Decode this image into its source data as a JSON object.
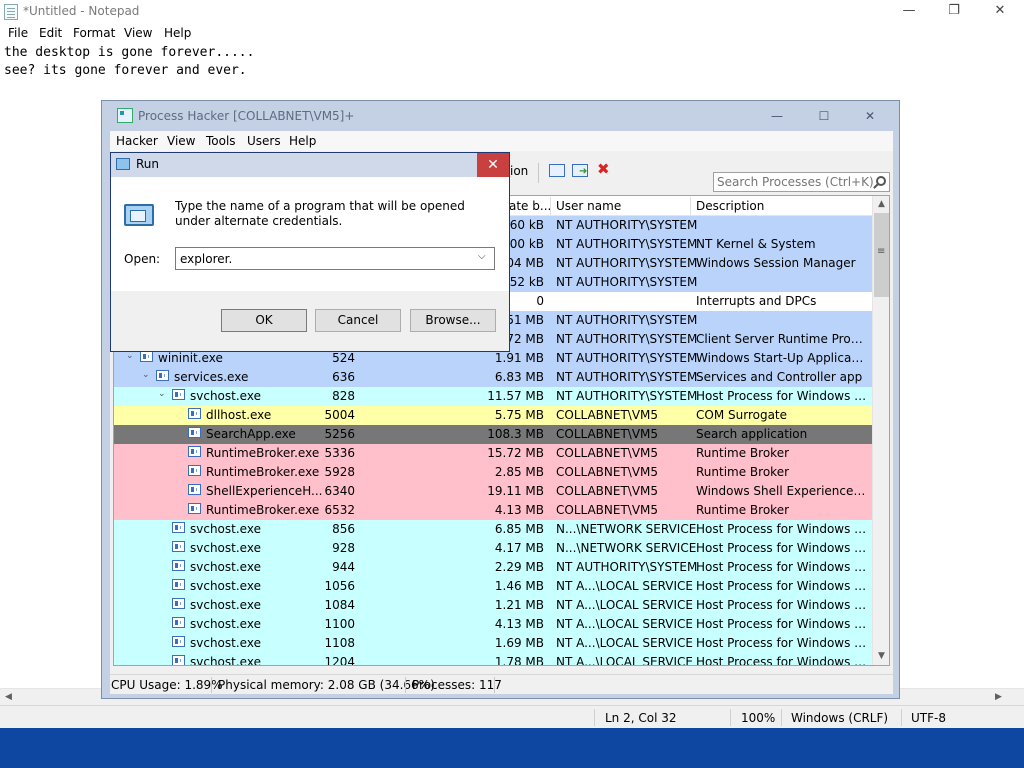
{
  "notepad": {
    "title": "*Untitled - Notepad",
    "window_buttons": {
      "minimize": "—",
      "maximize": "❐",
      "close": "✕"
    },
    "menu": [
      "File",
      "Edit",
      "Format",
      "View",
      "Help"
    ],
    "text_lines": [
      "the desktop is gone forever.....",
      "see? its gone forever and ever."
    ],
    "status": {
      "position": "Ln 2, Col 32",
      "zoom": "100%",
      "line_ending": "Windows (CRLF)",
      "encoding": "UTF-8"
    }
  },
  "process_hacker": {
    "title": "Process Hacker [COLLABNET\\VM5]+",
    "window_buttons": {
      "minimize": "—",
      "maximize": "☐",
      "close": "✕"
    },
    "menu": [
      "Hacker",
      "View",
      "Tools",
      "Users",
      "Help"
    ],
    "toolbar": {
      "partial_label": "ion"
    },
    "search_placeholder": "Search Processes (Ctrl+K)",
    "columns": {
      "private_bytes": "ate b...",
      "user_name": "User name",
      "description": "Description"
    },
    "rows": [
      {
        "name": "",
        "pid": "",
        "mem": "60 kB",
        "user": "NT AUTHORITY\\SYSTEM",
        "desc": "",
        "color": "#b9d3fb",
        "indent": 0,
        "expander": ""
      },
      {
        "name": "",
        "pid": "",
        "mem": "200 kB",
        "user": "NT AUTHORITY\\SYSTEM",
        "desc": "NT Kernel & System",
        "color": "#b9d3fb",
        "indent": 0,
        "expander": ""
      },
      {
        "name": "",
        "pid": "",
        "mem": "04 MB",
        "user": "NT AUTHORITY\\SYSTEM",
        "desc": "Windows Session Manager",
        "color": "#b9d3fb",
        "indent": 0,
        "expander": ""
      },
      {
        "name": "",
        "pid": "",
        "mem": "252 kB",
        "user": "NT AUTHORITY\\SYSTEM",
        "desc": "",
        "color": "#b9d3fb",
        "indent": 0,
        "expander": ""
      },
      {
        "name": "",
        "pid": "",
        "mem": "0",
        "user": "",
        "desc": "Interrupts and DPCs",
        "color": "#ffffff",
        "indent": 0,
        "expander": ""
      },
      {
        "name": "",
        "pid": "",
        "mem": "51 MB",
        "user": "NT AUTHORITY\\SYSTEM",
        "desc": "",
        "color": "#b9d3fb",
        "indent": 0,
        "expander": ""
      },
      {
        "name": "",
        "pid": "",
        "mem": "72 MB",
        "user": "NT AUTHORITY\\SYSTEM",
        "desc": "Client Server Runtime Process",
        "color": "#b9d3fb",
        "indent": 0,
        "expander": ""
      },
      {
        "name": "wininit.exe",
        "pid": "524",
        "mem": "1.91 MB",
        "user": "NT AUTHORITY\\SYSTEM",
        "desc": "Windows Start-Up Application",
        "color": "#b9d3fb",
        "indent": 0,
        "expander": "⌄"
      },
      {
        "name": "services.exe",
        "pid": "636",
        "mem": "6.83 MB",
        "user": "NT AUTHORITY\\SYSTEM",
        "desc": "Services and Controller app",
        "color": "#b9d3fb",
        "indent": 1,
        "expander": "⌄"
      },
      {
        "name": "svchost.exe",
        "pid": "828",
        "mem": "11.57 MB",
        "user": "NT AUTHORITY\\SYSTEM",
        "desc": "Host Process for Windows Ser...",
        "color": "#c8ffff",
        "indent": 2,
        "expander": "⌄"
      },
      {
        "name": "dllhost.exe",
        "pid": "5004",
        "mem": "5.75 MB",
        "user": "COLLABNET\\VM5",
        "desc": "COM Surrogate",
        "color": "#ffffa8",
        "indent": 3,
        "expander": ""
      },
      {
        "name": "SearchApp.exe",
        "pid": "5256",
        "mem": "108.3 MB",
        "user": "COLLABNET\\VM5",
        "desc": "Search application",
        "color": "#777777",
        "indent": 3,
        "expander": ""
      },
      {
        "name": "RuntimeBroker.exe",
        "pid": "5336",
        "mem": "15.72 MB",
        "user": "COLLABNET\\VM5",
        "desc": "Runtime Broker",
        "color": "#ffc0cb",
        "indent": 3,
        "expander": ""
      },
      {
        "name": "RuntimeBroker.exe",
        "pid": "5928",
        "mem": "2.85 MB",
        "user": "COLLABNET\\VM5",
        "desc": "Runtime Broker",
        "color": "#ffc0cb",
        "indent": 3,
        "expander": ""
      },
      {
        "name": "ShellExperienceH...",
        "pid": "6340",
        "mem": "19.11 MB",
        "user": "COLLABNET\\VM5",
        "desc": "Windows Shell Experience Host",
        "color": "#ffc0cb",
        "indent": 3,
        "expander": ""
      },
      {
        "name": "RuntimeBroker.exe",
        "pid": "6532",
        "mem": "4.13 MB",
        "user": "COLLABNET\\VM5",
        "desc": "Runtime Broker",
        "color": "#ffc0cb",
        "indent": 3,
        "expander": ""
      },
      {
        "name": "svchost.exe",
        "pid": "856",
        "mem": "6.85 MB",
        "user": "N...\\NETWORK SERVICE",
        "desc": "Host Process for Windows Ser...",
        "color": "#c8ffff",
        "indent": 2,
        "expander": ""
      },
      {
        "name": "svchost.exe",
        "pid": "928",
        "mem": "4.17 MB",
        "user": "N...\\NETWORK SERVICE",
        "desc": "Host Process for Windows Ser...",
        "color": "#c8ffff",
        "indent": 2,
        "expander": ""
      },
      {
        "name": "svchost.exe",
        "pid": "944",
        "mem": "2.29 MB",
        "user": "NT AUTHORITY\\SYSTEM",
        "desc": "Host Process for Windows Ser...",
        "color": "#c8ffff",
        "indent": 2,
        "expander": ""
      },
      {
        "name": "svchost.exe",
        "pid": "1056",
        "mem": "1.46 MB",
        "user": "NT A...\\LOCAL SERVICE",
        "desc": "Host Process for Windows Ser...",
        "color": "#c8ffff",
        "indent": 2,
        "expander": ""
      },
      {
        "name": "svchost.exe",
        "pid": "1084",
        "mem": "1.21 MB",
        "user": "NT A...\\LOCAL SERVICE",
        "desc": "Host Process for Windows Ser...",
        "color": "#c8ffff",
        "indent": 2,
        "expander": ""
      },
      {
        "name": "svchost.exe",
        "pid": "1100",
        "mem": "4.13 MB",
        "user": "NT A...\\LOCAL SERVICE",
        "desc": "Host Process for Windows Ser...",
        "color": "#c8ffff",
        "indent": 2,
        "expander": ""
      },
      {
        "name": "svchost.exe",
        "pid": "1108",
        "mem": "1.69 MB",
        "user": "NT A...\\LOCAL SERVICE",
        "desc": "Host Process for Windows Ser...",
        "color": "#c8ffff",
        "indent": 2,
        "expander": ""
      },
      {
        "name": "svchost.exe",
        "pid": "1204",
        "mem": "1.78 MB",
        "user": "NT A...\\LOCAL SERVICE",
        "desc": "Host Process for Windows Ser...",
        "color": "#c8ffff",
        "indent": 2,
        "expander": ""
      }
    ],
    "status": {
      "cpu": "CPU Usage: 1.89%",
      "memory": "Physical memory: 2.08 GB (34.66%)",
      "processes": "Processes: 117"
    }
  },
  "run_dialog": {
    "title": "Run",
    "close": "✕",
    "description": "Type the name of a program that will be opened under alternate credentials.",
    "open_label": "Open:",
    "open_value": "explorer.",
    "ok": "OK",
    "cancel": "Cancel",
    "browse": "Browse..."
  },
  "colors": {
    "taskbar": "#0d47a1",
    "system_process": "#b9d3fb",
    "service": "#c8ffff",
    "user_process": "#ffc0cb",
    "selected": "#777777",
    "com": "#ffffa8"
  }
}
